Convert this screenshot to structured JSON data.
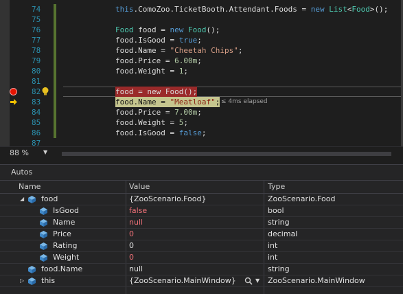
{
  "editor": {
    "lines": [
      {
        "num": "74"
      },
      {
        "num": "75"
      },
      {
        "num": "76"
      },
      {
        "num": "77"
      },
      {
        "num": "78"
      },
      {
        "num": "79"
      },
      {
        "num": "80"
      },
      {
        "num": "81"
      },
      {
        "num": "82"
      },
      {
        "num": "83"
      },
      {
        "num": "84"
      },
      {
        "num": "85"
      },
      {
        "num": "86"
      },
      {
        "num": "87"
      }
    ],
    "code": {
      "l74_a": "this",
      "l74_b": ".ComoZoo.TicketBooth.Attendant.Foods = ",
      "l74_c": "new",
      "l74_d": " ",
      "l74_e": "List",
      "l74_f": "<",
      "l74_g": "Food",
      "l74_h": ">();",
      "l76_a": "Food",
      "l76_b": " food = ",
      "l76_c": "new",
      "l76_d": " ",
      "l76_e": "Food",
      "l76_f": "();",
      "l77_a": "food.IsGood = ",
      "l77_b": "true",
      "l77_c": ";",
      "l78_a": "food.Name = ",
      "l78_b": "\"Cheetah Chips\"",
      "l78_c": ";",
      "l79_a": "food.Price = ",
      "l79_b": "6.00m",
      "l79_c": ";",
      "l80_a": "food.Weight = ",
      "l80_b": "1",
      "l80_c": ";",
      "l82_a": "food = ",
      "l82_b": "new",
      "l82_c": " Food();",
      "l83_a": "food.Name = ",
      "l83_b": "\"Meatloaf\"",
      "l83_c": ";",
      "l84_a": "food.Price = ",
      "l84_b": "7.00m",
      "l84_c": ";",
      "l85_a": "food.Weight = ",
      "l85_b": "5",
      "l85_c": ";",
      "l86_a": "food.IsGood = ",
      "l86_b": "false",
      "l86_c": ";"
    },
    "elapsed": "≤ 4ms elapsed",
    "zoom": "88 %"
  },
  "autos": {
    "title": "Autos",
    "headers": {
      "name": "Name",
      "value": "Value",
      "type": "Type"
    },
    "rows": [
      {
        "name": "food",
        "value": "{ZooScenario.Food}",
        "type": "ZooScenario.Food"
      },
      {
        "name": "IsGood",
        "value": "false",
        "type": "bool"
      },
      {
        "name": "Name",
        "value": "null",
        "type": "string"
      },
      {
        "name": "Price",
        "value": "0",
        "type": "decimal"
      },
      {
        "name": "Rating",
        "value": "0",
        "type": "int"
      },
      {
        "name": "Weight",
        "value": "0",
        "type": "int"
      },
      {
        "name": "food.Name",
        "value": "null",
        "type": "string"
      },
      {
        "name": "this",
        "value": "{ZooScenario.MainWindow}",
        "type": "ZooScenario.MainWindow"
      }
    ]
  },
  "colors": {
    "breakpoint": "#e51400",
    "current_line": "#c5c58e",
    "changed_value": "#f07178"
  }
}
